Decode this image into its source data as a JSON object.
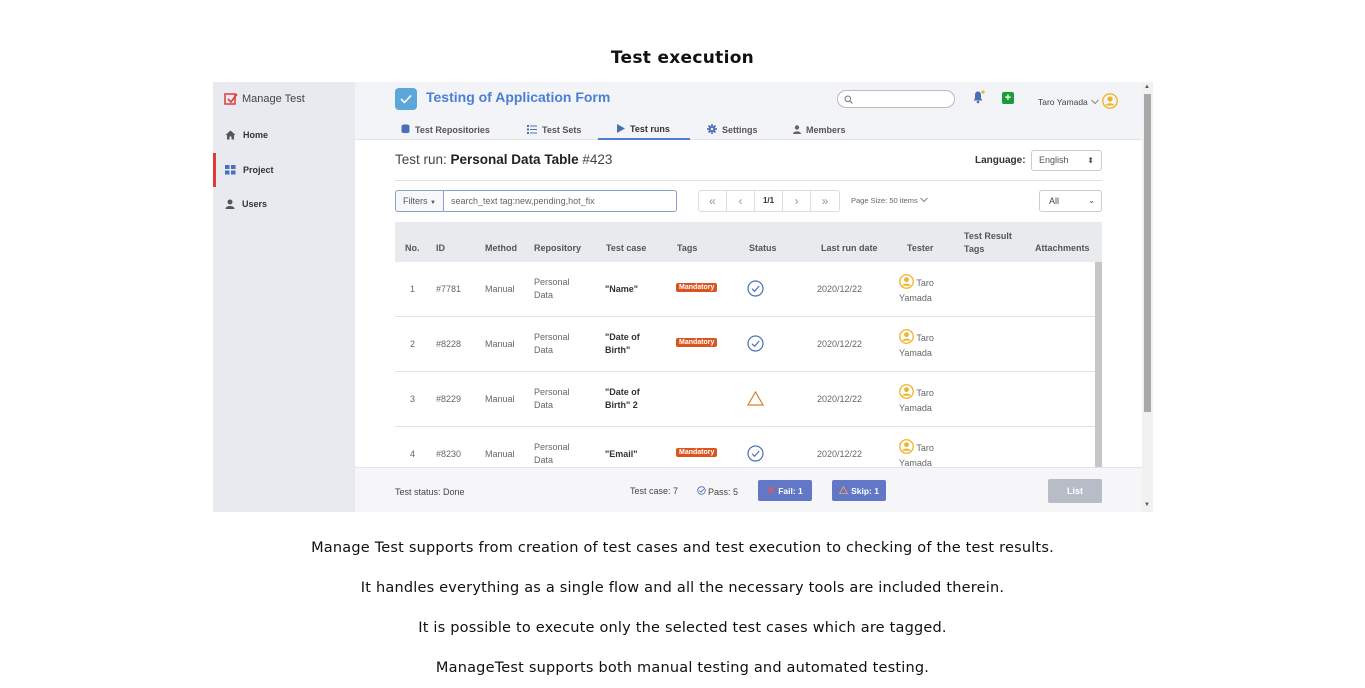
{
  "page_title": "Test execution",
  "sidebar": {
    "brand": "Manage Test",
    "items": [
      {
        "label": "Home",
        "icon": "home-icon"
      },
      {
        "label": "Project",
        "icon": "grid-icon",
        "active": true
      },
      {
        "label": "Users",
        "icon": "user-icon"
      }
    ]
  },
  "header": {
    "project_title": "Testing of Application Form",
    "user_name": "Taro Yamada",
    "tabs": [
      {
        "label": "Test Repositories",
        "icon": "database-icon"
      },
      {
        "label": "Test Sets",
        "icon": "list-icon"
      },
      {
        "label": "Test runs",
        "icon": "play-icon",
        "active": true
      },
      {
        "label": "Settings",
        "icon": "gear-icon"
      },
      {
        "label": "Members",
        "icon": "user-icon"
      }
    ]
  },
  "main": {
    "run_title_prefix": "Test run: ",
    "run_title_name": "Personal Data Table",
    "run_title_id": "#423",
    "language_label": "Language:",
    "language_value": "English",
    "filters_label": "Filters",
    "filters_value": "search_text tag:new,pending,hot_fix",
    "pager": {
      "first": "«",
      "prev": "‹",
      "current": "1/1",
      "next": "›",
      "last": "»"
    },
    "page_size": "Page Size: 50 items",
    "status_filter": "All"
  },
  "table": {
    "columns": [
      "No.",
      "ID",
      "Method",
      "Repository",
      "Test case",
      "Tags",
      "Status",
      "Last run date",
      "Tester",
      "Test Result Tags",
      "Attachments"
    ],
    "rows": [
      {
        "no": "1",
        "id": "#7781",
        "method": "Manual",
        "repo1": "Personal",
        "repo2": "Data",
        "case1": "\"Name\"",
        "case2": "",
        "tag": "Mandatory",
        "status": "pass",
        "date": "2020/12/22",
        "tester1": "Taro",
        "tester2": "Yamada"
      },
      {
        "no": "2",
        "id": "#8228",
        "method": "Manual",
        "repo1": "Personal",
        "repo2": "Data",
        "case1": "\"Date of",
        "case2": "Birth\"",
        "tag": "Mandatory",
        "status": "pass",
        "date": "2020/12/22",
        "tester1": "Taro",
        "tester2": "Yamada"
      },
      {
        "no": "3",
        "id": "#8229",
        "method": "Manual",
        "repo1": "Personal",
        "repo2": "Data",
        "case1": "\"Date of",
        "case2": "Birth\" 2",
        "tag": "",
        "status": "skip",
        "date": "2020/12/22",
        "tester1": "Taro",
        "tester2": "Yamada"
      },
      {
        "no": "4",
        "id": "#8230",
        "method": "Manual",
        "repo1": "Personal",
        "repo2": "Data",
        "case1": "\"Email\"",
        "case2": "",
        "tag": "Mandatory",
        "status": "pass",
        "date": "2020/12/22",
        "tester1": "Taro",
        "tester2": "Yamada"
      }
    ]
  },
  "footer": {
    "test_status": "Test status: Done",
    "test_case": "Test case: 7",
    "pass": "Pass: 5",
    "fail": "Fail: 1",
    "skip": "Skip: 1",
    "list_button": "List"
  },
  "captions": [
    "Manage Test supports from creation of test cases and test execution to checking of the test results.",
    "It handles everything as a single flow and all the necessary tools are included therein.",
    "It is possible to execute only the selected test cases which are tagged.",
    "ManageTest supports both manual testing and automated testing."
  ],
  "colors": {
    "accent": "#4a7fd4",
    "active_nav": "#e03a3a",
    "tag": "#d9541e",
    "pass": "#4a6fb8",
    "skip": "#d9822b",
    "footer_button": "#6377c7",
    "avatar": "#f0b429"
  }
}
